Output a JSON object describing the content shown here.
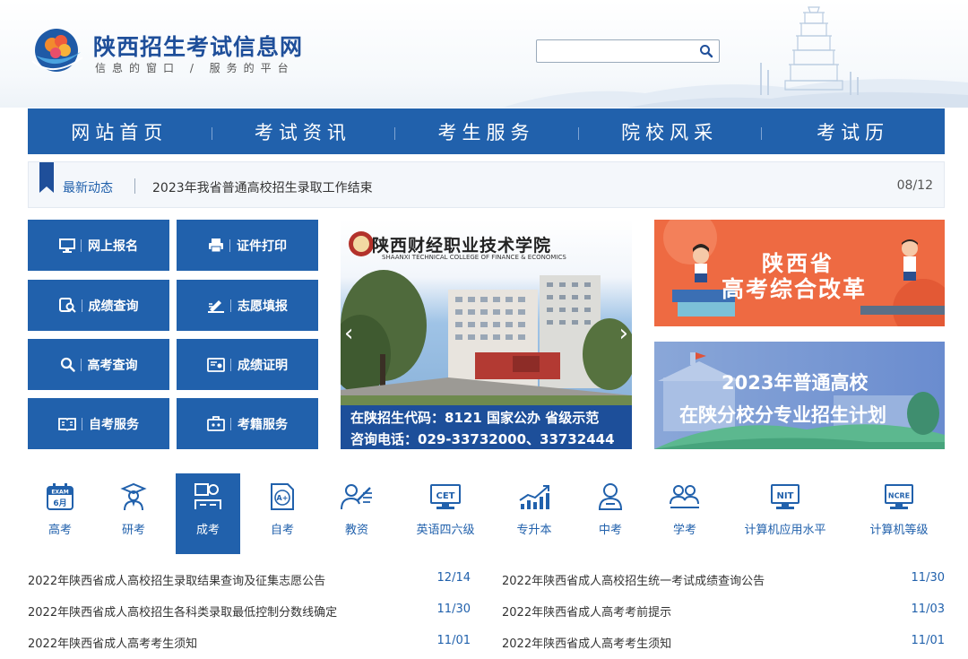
{
  "header": {
    "site_title": "陕西招生考试信息网",
    "slogan": "信息的窗口 / 服务的平台",
    "search_placeholder": ""
  },
  "nav": {
    "items": [
      "网站首页",
      "考试资讯",
      "考生服务",
      "院校风采",
      "考试历"
    ]
  },
  "ticker": {
    "label": "最新动态",
    "headline": "2023年我省普通高校招生录取工作结束",
    "date": "08/12"
  },
  "services": [
    {
      "label": "网上报名",
      "icon": "monitor-icon"
    },
    {
      "label": "证件打印",
      "icon": "printer-icon"
    },
    {
      "label": "成绩查询",
      "icon": "score-search-icon"
    },
    {
      "label": "志愿填报",
      "icon": "pen-form-icon"
    },
    {
      "label": "高考查询",
      "icon": "search-icon"
    },
    {
      "label": "成绩证明",
      "icon": "certificate-icon"
    },
    {
      "label": "自考服务",
      "icon": "book-icon"
    },
    {
      "label": "考籍服务",
      "icon": "briefcase-icon"
    }
  ],
  "slider": {
    "college_name": "陕西财经职业技术学院",
    "college_name_en": "SHAANXI TECHNICAL COLLEGE OF FINANCE & ECONOMICS",
    "caption_line1": "在陕招生代码：8121 国家公办 省级示范",
    "caption_line2": "咨询电话：029-33732000、33732444"
  },
  "banners": {
    "reform_line1": "陕西省",
    "reform_line2": "高考综合改革",
    "plan_line1": "2023年普通高校",
    "plan_line2": "在陕分校分专业招生计划"
  },
  "tabs": [
    {
      "label": "高考",
      "icon": "exam-calendar-icon",
      "icon_top": "EXAM",
      "icon_bottom": "6月"
    },
    {
      "label": "研考",
      "icon": "graduate-icon"
    },
    {
      "label": "成考",
      "icon": "adult-exam-icon",
      "active": true
    },
    {
      "label": "自考",
      "icon": "self-study-icon",
      "icon_text": "A+"
    },
    {
      "label": "教资",
      "icon": "teacher-icon"
    },
    {
      "label": "英语四六级",
      "icon": "cet-icon",
      "icon_text": "CET"
    },
    {
      "label": "专升本",
      "icon": "growth-chart-icon"
    },
    {
      "label": "中考",
      "icon": "student-icon"
    },
    {
      "label": "学考",
      "icon": "group-study-icon"
    },
    {
      "label": "计算机应用水平",
      "icon": "nit-icon",
      "icon_text": "NIT"
    },
    {
      "label": "计算机等级",
      "icon": "ncre-icon",
      "icon_text": "NCRE"
    }
  ],
  "news": [
    {
      "title": "2022年陕西省成人高校招生录取结果查询及征集志愿公告",
      "date": "12/14"
    },
    {
      "title": "2022年陕西省成人高校招生统一考试成绩查询公告",
      "date": "11/30"
    },
    {
      "title": "2022年陕西省成人高校招生各科类录取最低控制分数线确定",
      "date": "11/30"
    },
    {
      "title": "2022年陕西省成人高考考前提示",
      "date": "11/03"
    },
    {
      "title": "2022年陕西省成人高考考生须知",
      "date": "11/01"
    },
    {
      "title": "2022年陕西省成人高考考生须知",
      "date": "11/01"
    }
  ],
  "colors": {
    "primary": "#2161ac",
    "title_blue": "#1f4f9a",
    "banner_orange": "#ee6a42",
    "banner_blue": "#6f8fcf"
  }
}
